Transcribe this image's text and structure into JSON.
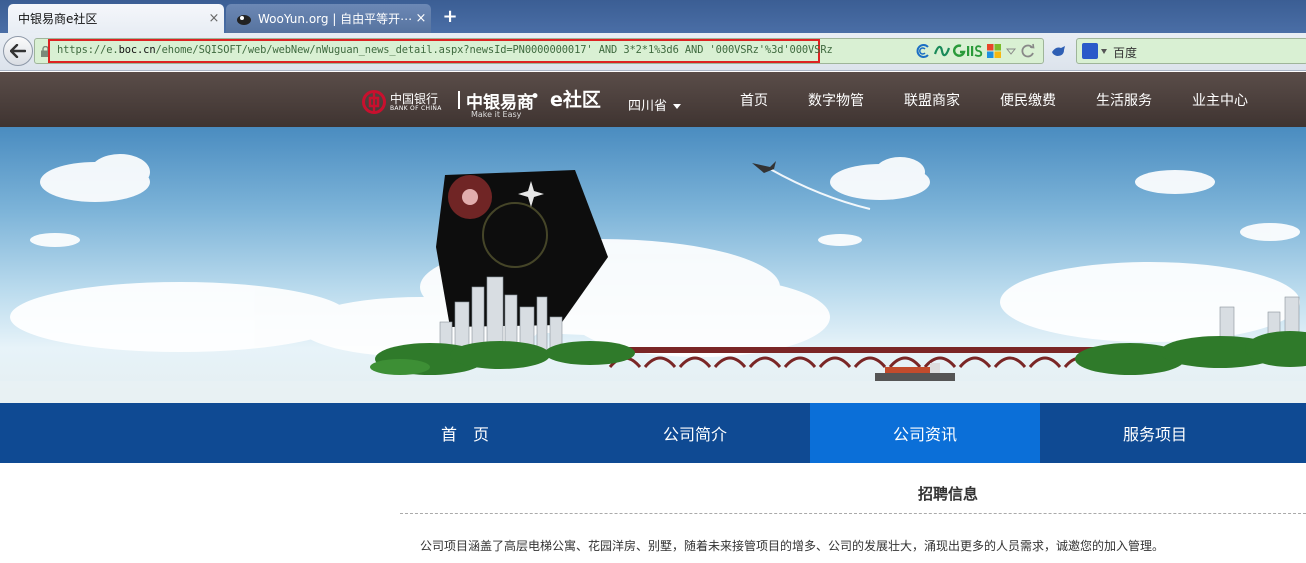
{
  "browser": {
    "tabs": [
      {
        "title": "中银易商e社区",
        "active": true
      },
      {
        "title": "WooYun.org | 自由平等开⋯",
        "active": false
      }
    ],
    "close_glyph": "×",
    "newtab_glyph": "+",
    "url": {
      "prefix": "https://e.",
      "domain": "boc.cn",
      "path": "/ehome/SQISOFT/web/webNew/nWuguan_news_detail.aspx?newsId=PN0000000017' AND 3*2*1%3d6 AND '000VSRz'%3d'000VSRz"
    },
    "url_icons": [
      "curl-icon",
      "wave-icon",
      "giis-icon",
      "windows-icon",
      "dropdown-icon",
      "reload-icon"
    ],
    "search": {
      "engine": "baidu-icon",
      "placeholder": "百度"
    }
  },
  "header": {
    "boc_logo_cn": "中国银行",
    "boc_logo_en": "BANK OF CHINA",
    "brand_cn": "中银易商",
    "brand_slogan": "Make it Easy",
    "brand_dot": "•",
    "brand_e": "e社区",
    "province": "四川省",
    "nav": [
      "首页",
      "数字物管",
      "联盟商家",
      "便民缴费",
      "生活服务",
      "业主中心"
    ]
  },
  "mainnav": {
    "items": [
      "首　页",
      "公司简介",
      "公司资讯",
      "服务项目"
    ],
    "active_index": 2
  },
  "content": {
    "section_title": "招聘信息",
    "paragraph": "公司项目涵盖了高层电梯公寓、花园洋房、别墅，随着未来接管项目的增多、公司的发展壮大，涌现出更多的人员需求，诚邀您的加入管理。"
  },
  "colors": {
    "tabbar": "#3b5e94",
    "urlbar_bg": "#d9f0d3",
    "url_highlight": "#dd2222",
    "site_header": "#4a3f3c",
    "mainnav": "#0f4a93",
    "mainnav_active": "#0b6fd8"
  }
}
